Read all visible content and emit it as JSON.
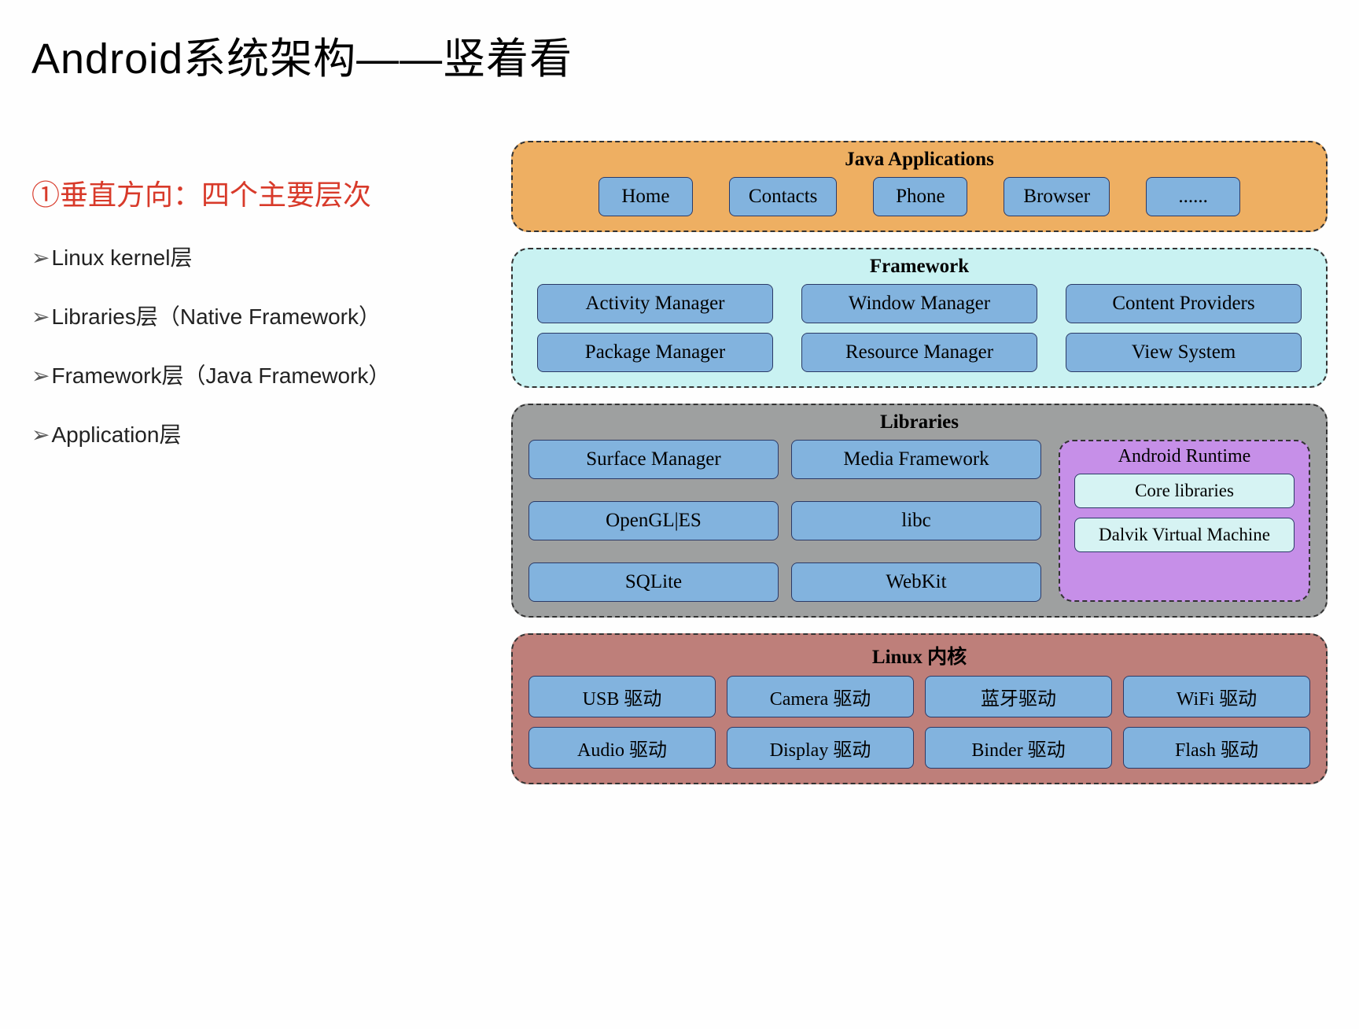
{
  "title": "Android系统架构——竖着看",
  "left": {
    "section_head": "①垂直方向：四个主要层次",
    "bullets": [
      "Linux kernel层",
      "Libraries层（Native Framework）",
      "Framework层（Java Framework）",
      "Application层"
    ]
  },
  "layers": {
    "apps": {
      "title": "Java Applications",
      "items": [
        "Home",
        "Contacts",
        "Phone",
        "Browser",
        "......"
      ]
    },
    "framework": {
      "title": "Framework",
      "row1": [
        "Activity Manager",
        "Window Manager",
        "Content Providers"
      ],
      "row2": [
        "Package Manager",
        "Resource Manager",
        "View System"
      ]
    },
    "libraries": {
      "title": "Libraries",
      "row1": [
        "Surface Manager",
        "Media Framework"
      ],
      "row2": [
        "OpenGL|ES",
        "libc"
      ],
      "row3": [
        "SQLite",
        "WebKit"
      ],
      "runtime": {
        "title": "Android Runtime",
        "items": [
          "Core libraries",
          "Dalvik Virtual Machine"
        ]
      }
    },
    "kernel": {
      "title": "Linux 内核",
      "row1": [
        "USB  驱动",
        "Camera 驱动",
        "蓝牙驱动",
        "WiFi 驱动"
      ],
      "row2": [
        "Audio 驱动",
        "Display 驱动",
        "Binder 驱动",
        "Flash 驱动"
      ]
    }
  }
}
